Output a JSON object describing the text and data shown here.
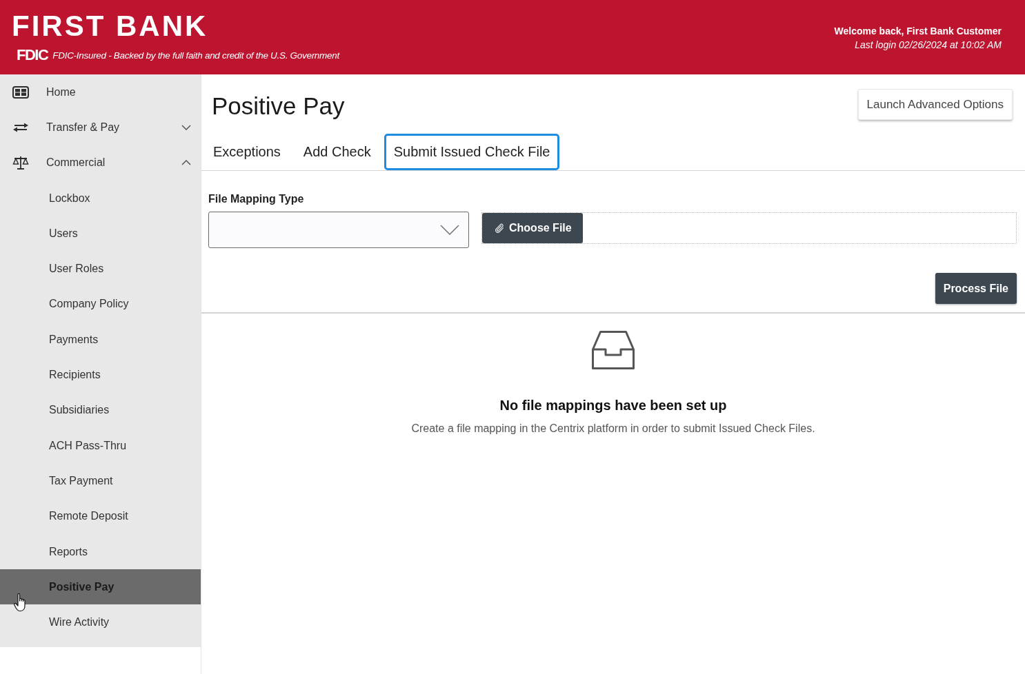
{
  "header": {
    "brand": "FIRST BANK",
    "fdic_logo": "FDIC",
    "fdic_notice": "FDIC-Insured - Backed by the full faith and credit of the U.S. Government",
    "welcome": "Welcome back, First Bank Customer",
    "last_login": "Last login 02/26/2024 at 10:02 AM"
  },
  "sidebar": {
    "items": [
      {
        "label": "Home",
        "kind": "link",
        "selected": false
      },
      {
        "label": "Transfer & Pay",
        "kind": "group",
        "expanded": false,
        "selected": false
      },
      {
        "label": "Commercial",
        "kind": "group",
        "expanded": true,
        "selected": false,
        "children": [
          {
            "label": "Lockbox",
            "selected": false
          },
          {
            "label": "Users",
            "selected": false
          },
          {
            "label": "User Roles",
            "selected": false
          },
          {
            "label": "Company Policy",
            "selected": false
          },
          {
            "label": "Payments",
            "selected": false
          },
          {
            "label": "Recipients",
            "selected": false
          },
          {
            "label": "Subsidiaries",
            "selected": false
          },
          {
            "label": "ACH Pass-Thru",
            "selected": false
          },
          {
            "label": "Tax Payment",
            "selected": false
          },
          {
            "label": "Remote Deposit",
            "selected": false
          },
          {
            "label": "Reports",
            "selected": false
          },
          {
            "label": "Positive Pay",
            "selected": true
          },
          {
            "label": "Wire Activity",
            "selected": false
          }
        ]
      }
    ]
  },
  "page": {
    "title": "Positive Pay",
    "action_button": "Launch Advanced Options",
    "tabs": [
      {
        "label": "Exceptions",
        "selected": false
      },
      {
        "label": "Add Check",
        "selected": false
      },
      {
        "label": "Submit Issued Check File",
        "selected": true
      }
    ],
    "form": {
      "field_label": "File Mapping Type",
      "choose_file_button": "Choose File",
      "process_button": "Process File"
    },
    "empty_state": {
      "title": "No file mappings have been set up",
      "message": "Create a file mapping in the Centrix platform in order to submit Issued Check Files."
    }
  }
}
